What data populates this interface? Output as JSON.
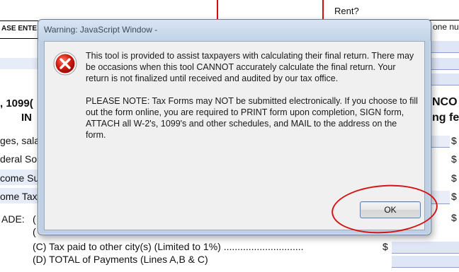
{
  "dialog": {
    "title": "Warning: JavaScript Window -",
    "message_1": "This tool is provided to assist taxpayers with calculating their final return. There may be occasions when this tool CANNOT accurately calculate the final return. Your return is not finalized until received and audited by our tax office.",
    "message_2": "PLEASE NOTE: Tax Forms may NOT be submitted electronically. If you choose to fill out the form online, you are required to PRINT form upon completion, SIGN form, ATTACH all W-2's, 1099's and other schedules, and MAIL to the address on the form.",
    "ok_label": "OK",
    "icon": "error-icon"
  },
  "form": {
    "rent_label": "Rent?",
    "none_label": "one nu",
    "please_enter": "ASE ENTE",
    "section_left_1": ", 1099(",
    "section_left_2": "IN",
    "section_right_1": "NCO",
    "section_right_2": "ng fee",
    "row_wages": "ges, sala",
    "row_federal": "deral So",
    "row_income_sub": "come Su",
    "row_income_tax": "ome Tax",
    "row_ade": "ADE:",
    "row_b_paren": "(",
    "row_c_paren": "(",
    "row_c": "(C) Tax paid to other city(s) (Limited to 1%) .............................",
    "row_d": "(D) TOTAL of Payments (Lines A,B & C)",
    "dollar": "$"
  },
  "colors": {
    "annotation": "#d31515",
    "form_border_red": "#d01010",
    "field_fill": "#dfe6f6"
  }
}
